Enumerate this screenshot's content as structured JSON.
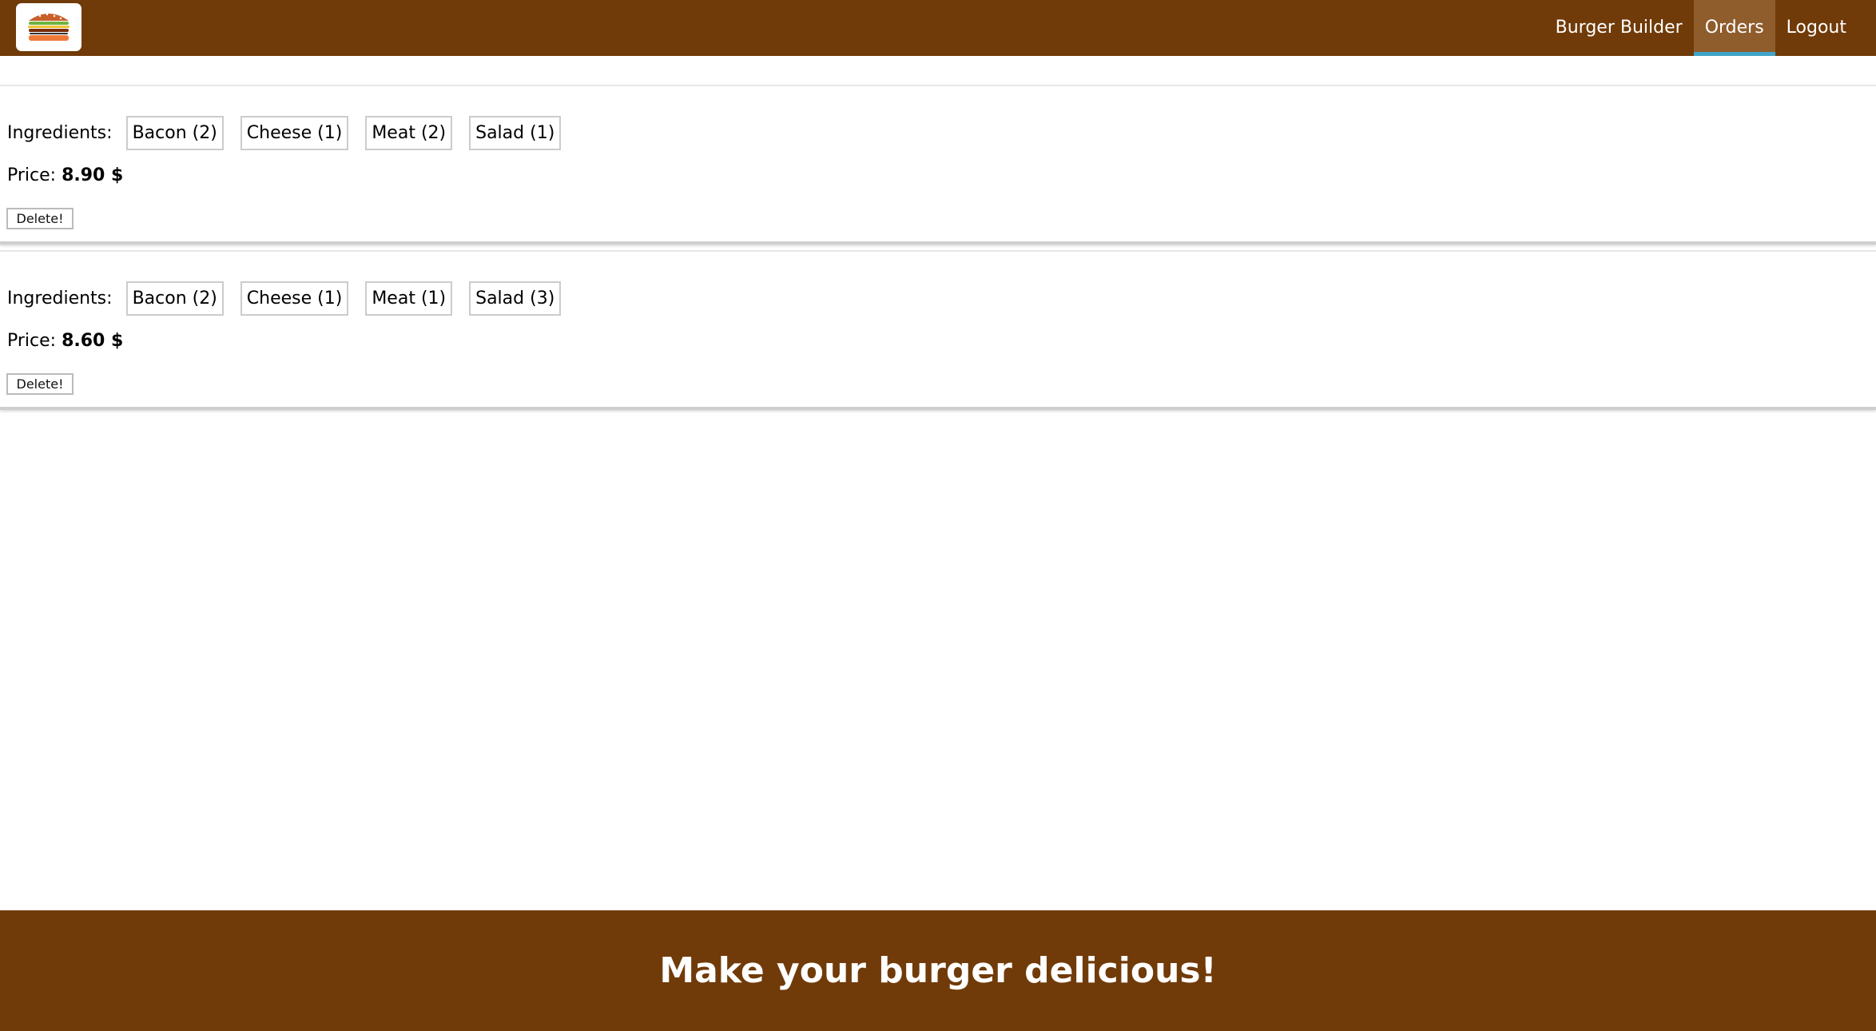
{
  "header": {
    "logo_icon": "burger-icon",
    "nav": [
      {
        "label": "Burger Builder",
        "active": false
      },
      {
        "label": "Orders",
        "active": true
      },
      {
        "label": "Logout",
        "active": false
      }
    ]
  },
  "orders": [
    {
      "ingredients_label": "Ingredients:",
      "ingredients": [
        "Bacon (2)",
        "Cheese (1)",
        "Meat (2)",
        "Salad (1)"
      ],
      "price_label": "Price:",
      "price_value": "8.90 $",
      "delete_label": "Delete!"
    },
    {
      "ingredients_label": "Ingredients:",
      "ingredients": [
        "Bacon (2)",
        "Cheese (1)",
        "Meat (1)",
        "Salad (3)"
      ],
      "price_label": "Price:",
      "price_value": "8.60 $",
      "delete_label": "Delete!"
    }
  ],
  "footer": {
    "title": "Make your burger delicious!"
  },
  "colors": {
    "brand_brown": "#703B09",
    "active_nav": "#8F5C2C",
    "active_underline": "#40A4C8"
  }
}
